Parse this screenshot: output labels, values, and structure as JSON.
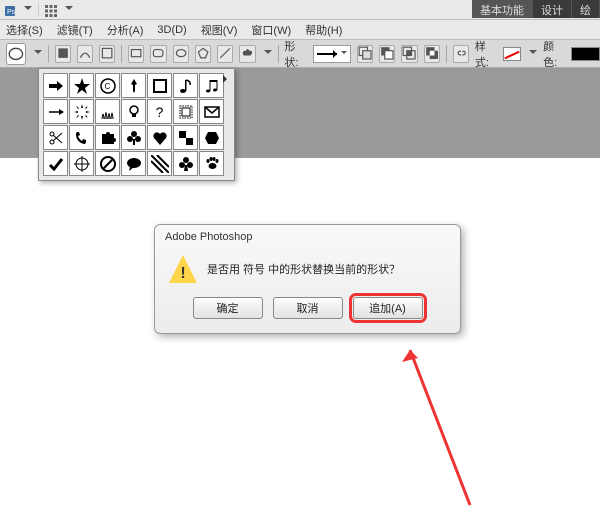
{
  "tabs": {
    "basic": "基本功能",
    "design": "设计",
    "paint": "绘"
  },
  "menu": {
    "select": "选择(S)",
    "filter": "滤镜(T)",
    "analysis": "分析(A)",
    "threed": "3D(D)",
    "view": "视图(V)",
    "window": "窗口(W)",
    "help": "帮助(H)"
  },
  "optbar": {
    "shape_label": "形状:",
    "style_label": "样式:",
    "color_label": "颜色:"
  },
  "dialog": {
    "title": "Adobe Photoshop",
    "message": "是否用 符号 中的形状替换当前的形状？",
    "ok": "确定",
    "cancel": "取消",
    "append": "追加(A)"
  }
}
